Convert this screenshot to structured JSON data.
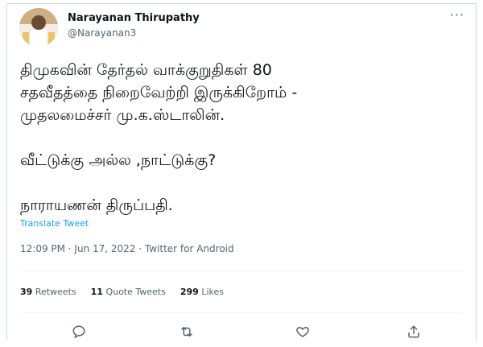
{
  "tweet": {
    "author_name": "Narayanan Thirupathy",
    "author_handle": "@Narayanan3",
    "more_icon": "more-icon",
    "text": "திமுகவின் தேர்தல் வாக்குறுதிகள் 80\nசதவீதத்தை நிறைவேற்றி இருக்கிறோம் -\nமுதலமைச்சர் மு.க.ஸ்டாலின்.\n\nவீட்டுக்கு அல்ல ,நாட்டுக்கு?\n\nநாராயணன் திருப்பதி.",
    "translate_label": "Translate Tweet",
    "timestamp": "12:09 PM · Jun 17, 2022 · Twitter for Android"
  },
  "stats": {
    "retweets_count": "39",
    "retweets_label": "Retweets",
    "quotes_count": "11",
    "quotes_label": "Quote Tweets",
    "likes_count": "299",
    "likes_label": "Likes"
  },
  "actions": [
    "reply-icon",
    "retweet-icon",
    "like-icon",
    "share-icon"
  ],
  "colors": {
    "link": "#1d9bf0",
    "secondary_text": "#536471",
    "primary_text": "#0f1419",
    "border": "#cfd9de"
  }
}
